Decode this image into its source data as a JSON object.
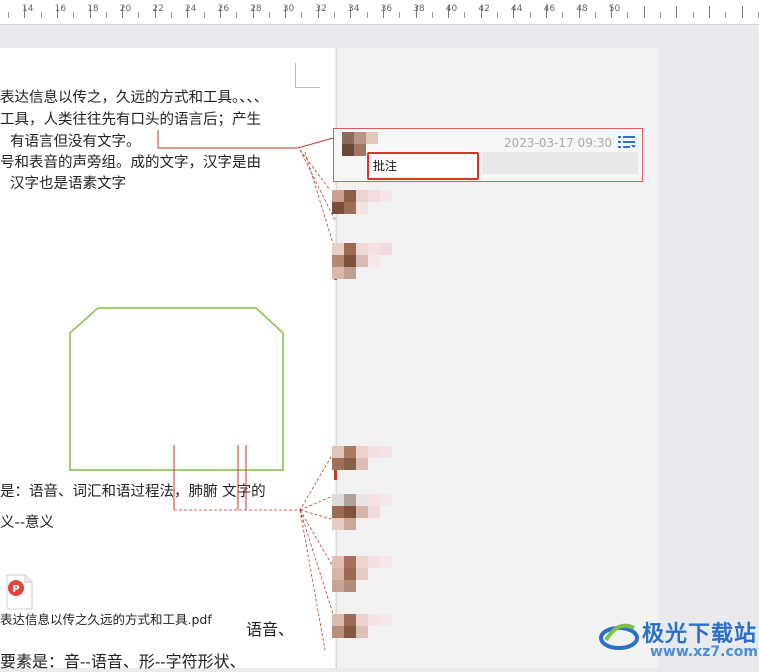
{
  "ruler": {
    "numbers": [
      "14",
      "16",
      "18",
      "20",
      "22",
      "24",
      "26",
      "28",
      "30",
      "32",
      "34",
      "36",
      "38",
      "40",
      "42",
      "44",
      "46",
      "48",
      "50"
    ]
  },
  "document": {
    "lines": [
      "表达信息以传之，久远的方式和工具。、、、",
      "工具，人类往往先有口头的语言后；产生",
      "有语言但没有文字。",
      "号和表音的声旁组。成的文字，汉字是由",
      "汉字也是语素文字",
      "是：语音、词汇和语过程法，肺腑  文字的",
      "义--意义",
      "语音、",
      "要素是：音--语音、形--字符形状、"
    ],
    "attachment_name": "表达信息以传之久远的方式和工具.pdf"
  },
  "comment_panel": {
    "active_comment": {
      "date": "2023-03-17 09:30",
      "input_value": "批注",
      "menu_icon": "list-menu-icon"
    }
  },
  "watermark": {
    "brand": "极光下载站",
    "url": "www.xz7.com"
  },
  "colors": {
    "highlight_red": "#d9342b",
    "shape_green": "#7cc243",
    "link_red": "#c0392b",
    "watermark_blue": "#2a6fc9"
  }
}
